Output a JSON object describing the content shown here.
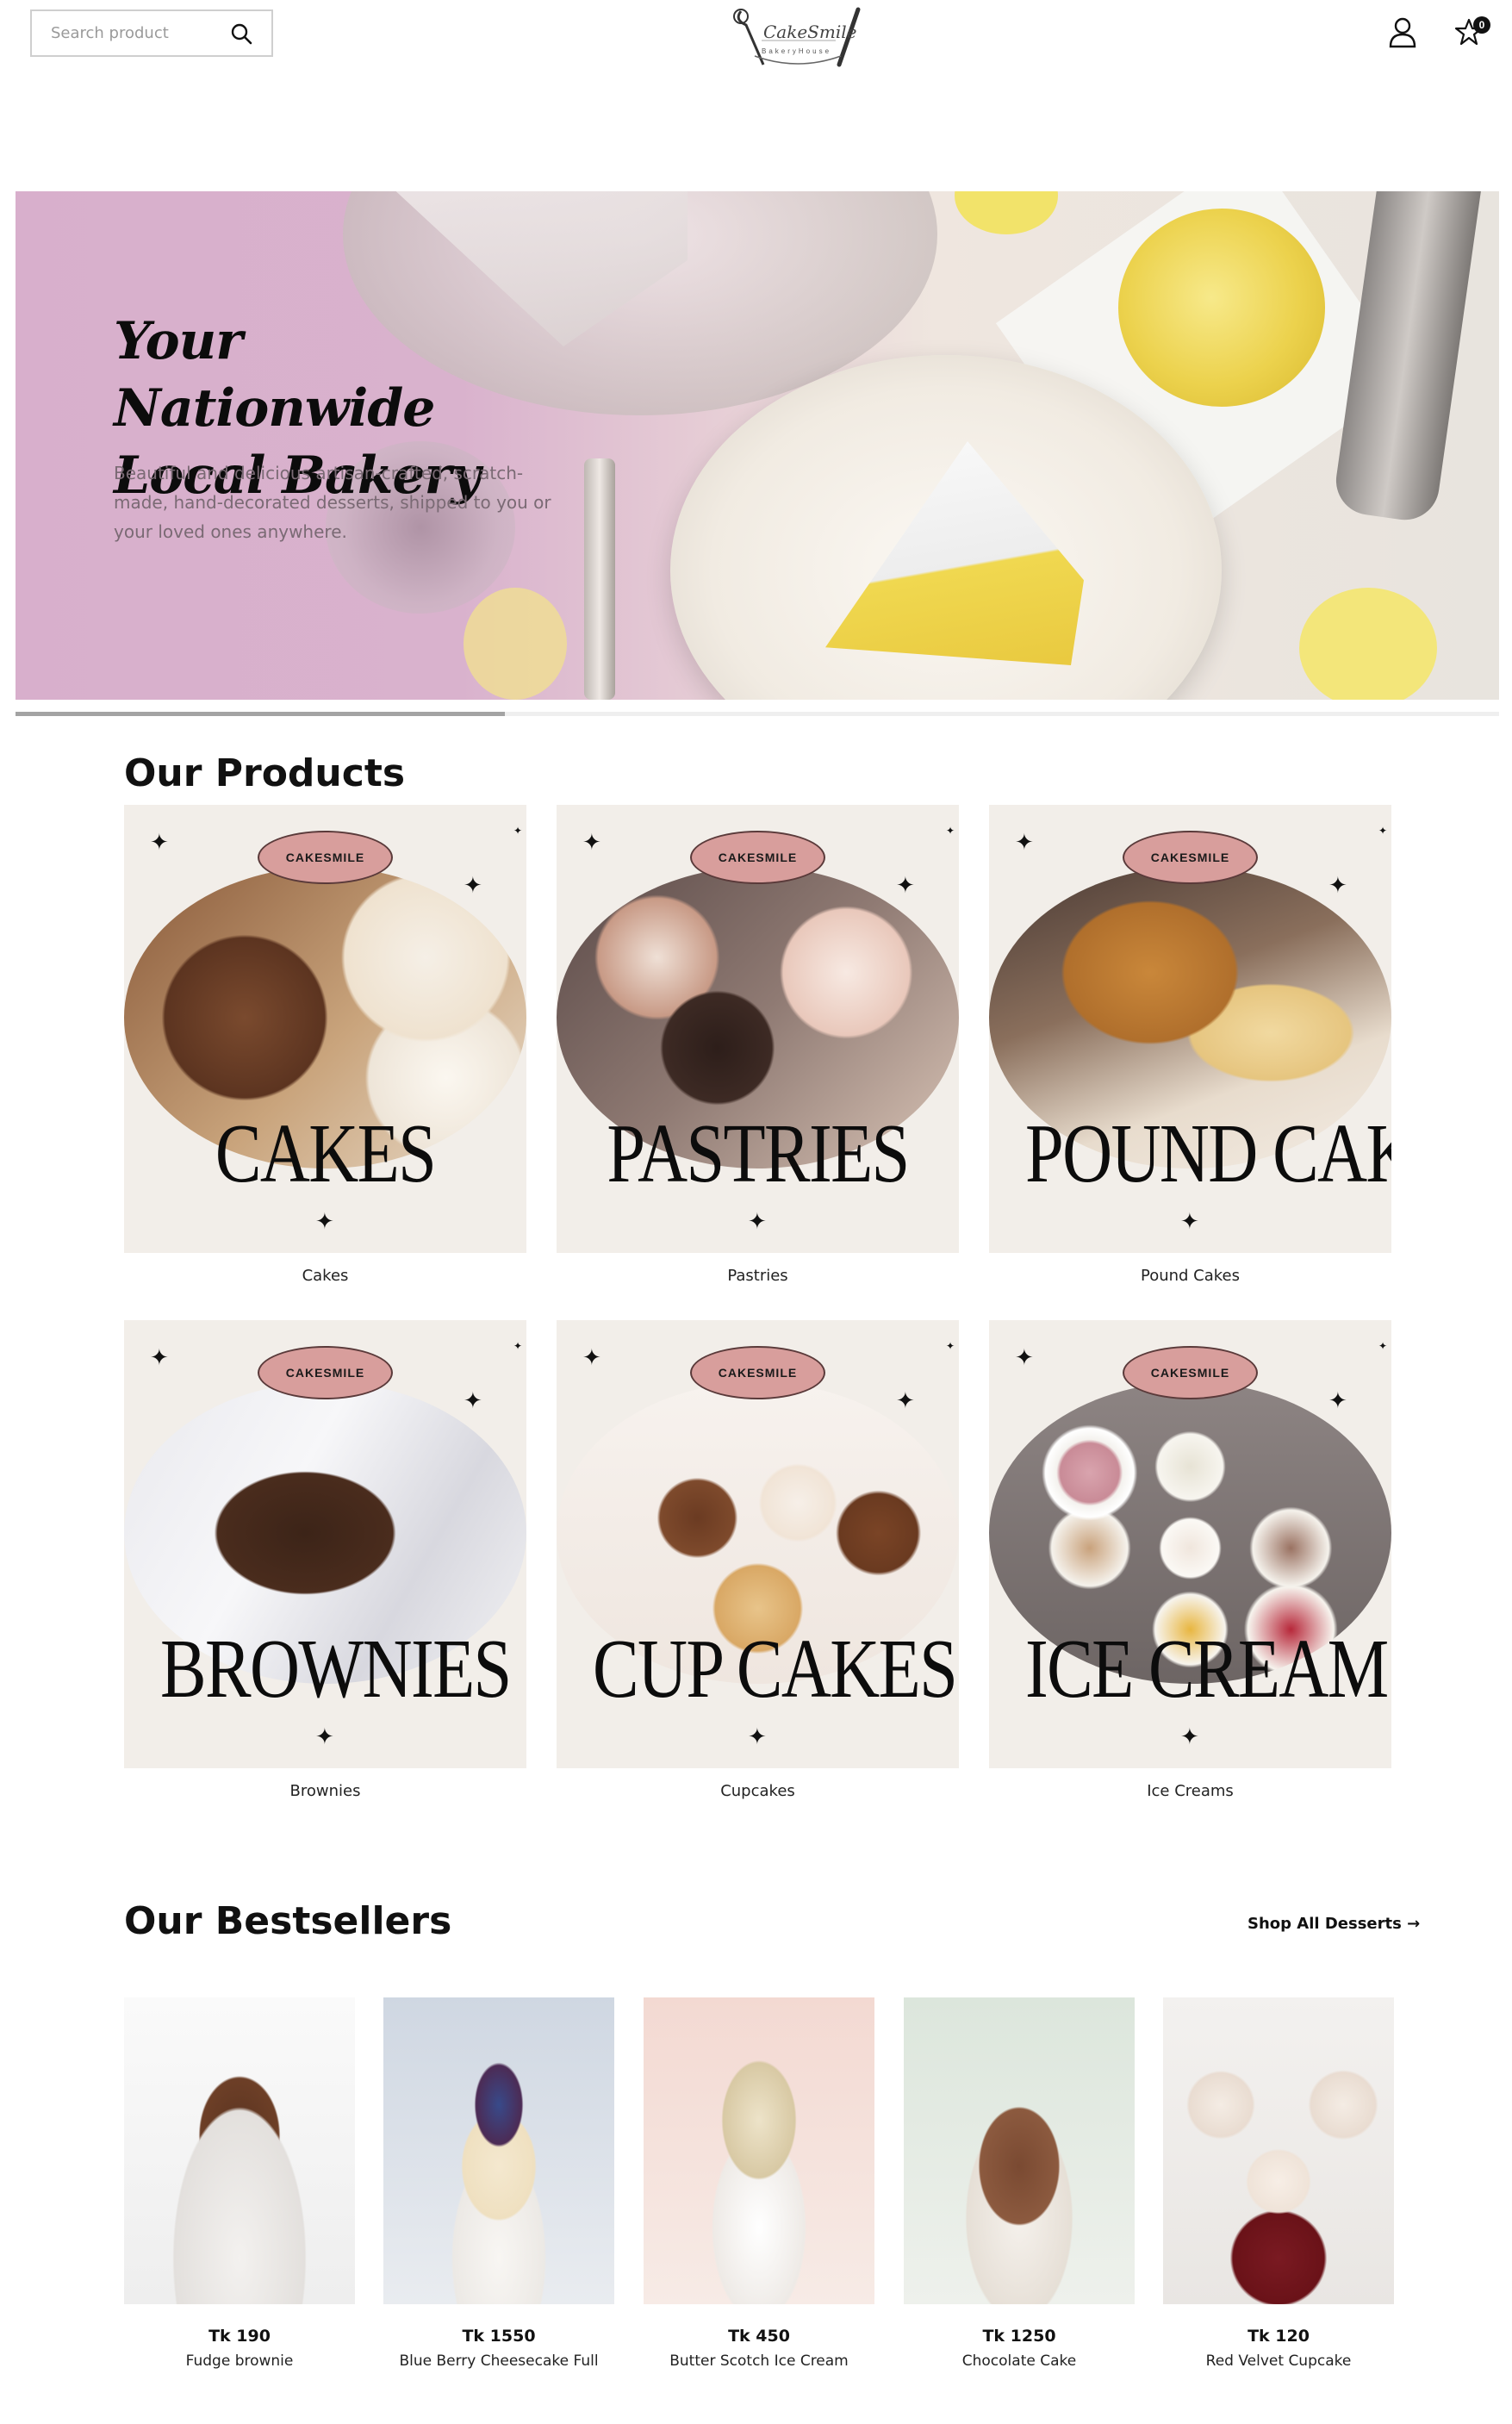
{
  "header": {
    "search_placeholder": "Search product",
    "logo_name": "CakeSmile",
    "logo_sub": "BakeryHouse",
    "cart_count": "0"
  },
  "hero": {
    "title_line1": "Your Nationwide",
    "title_line2": "Local Bakery",
    "description": "Beautiful and delicious artisan-crafted, scratch-made, hand-decorated desserts, shipped to you or your loved ones anywhere.",
    "slider_progress": 0.33
  },
  "products": {
    "title": "Our Products",
    "items": [
      {
        "badge": "CAKESMILE",
        "big": "CAKES",
        "label": "Cakes"
      },
      {
        "badge": "CAKESMILE",
        "big": "PASTRIES",
        "label": "Pastries"
      },
      {
        "badge": "CAKESMILE",
        "big": "POUND CAKE",
        "label": "Pound Cakes"
      },
      {
        "badge": "CAKESMILE",
        "big": "BROWNIES",
        "label": "Brownies"
      },
      {
        "badge": "CAKESMILE",
        "big": "CUP CAKES",
        "label": "Cupcakes"
      },
      {
        "badge": "CAKESMILE",
        "big": "ICE CREAM",
        "label": "Ice Creams"
      }
    ]
  },
  "bestsellers": {
    "title": "Our Bestsellers",
    "shop_all": "Shop All Desserts →",
    "items": [
      {
        "price": "Tk 190",
        "name": "Fudge brownie"
      },
      {
        "price": "Tk 1550",
        "name": "Blue Berry Cheesecake Full"
      },
      {
        "price": "Tk 450",
        "name": "Butter Scotch Ice Cream"
      },
      {
        "price": "Tk 1250",
        "name": "Chocolate Cake"
      },
      {
        "price": "Tk 120",
        "name": "Red Velvet Cupcake"
      }
    ]
  },
  "colors": {
    "hero_pink": "#d8afcc",
    "card_bg": "#f2eee9",
    "badge": "#d89e9c"
  }
}
